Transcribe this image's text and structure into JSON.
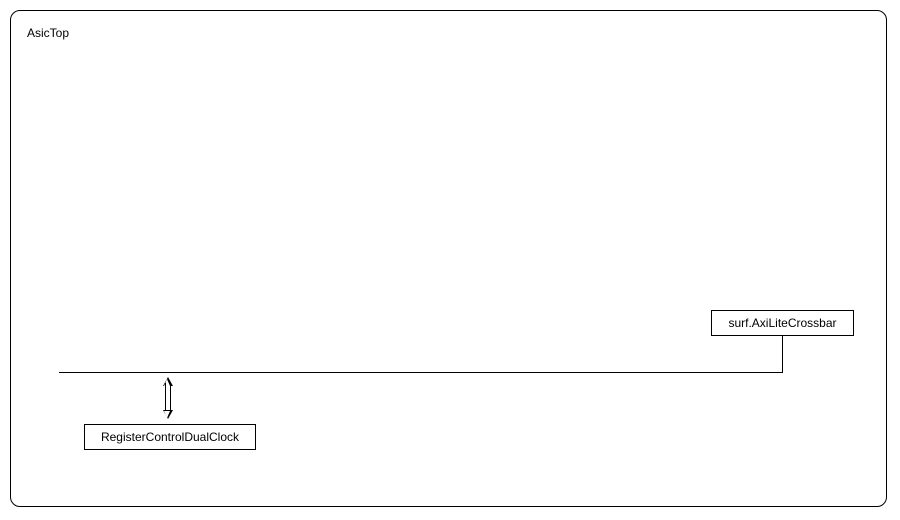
{
  "container": {
    "title": "AsicTop"
  },
  "blocks": {
    "crossbar": {
      "label": "surf.AxiLiteCrossbar"
    },
    "regctrl": {
      "label": "RegisterControlDualClock"
    }
  }
}
